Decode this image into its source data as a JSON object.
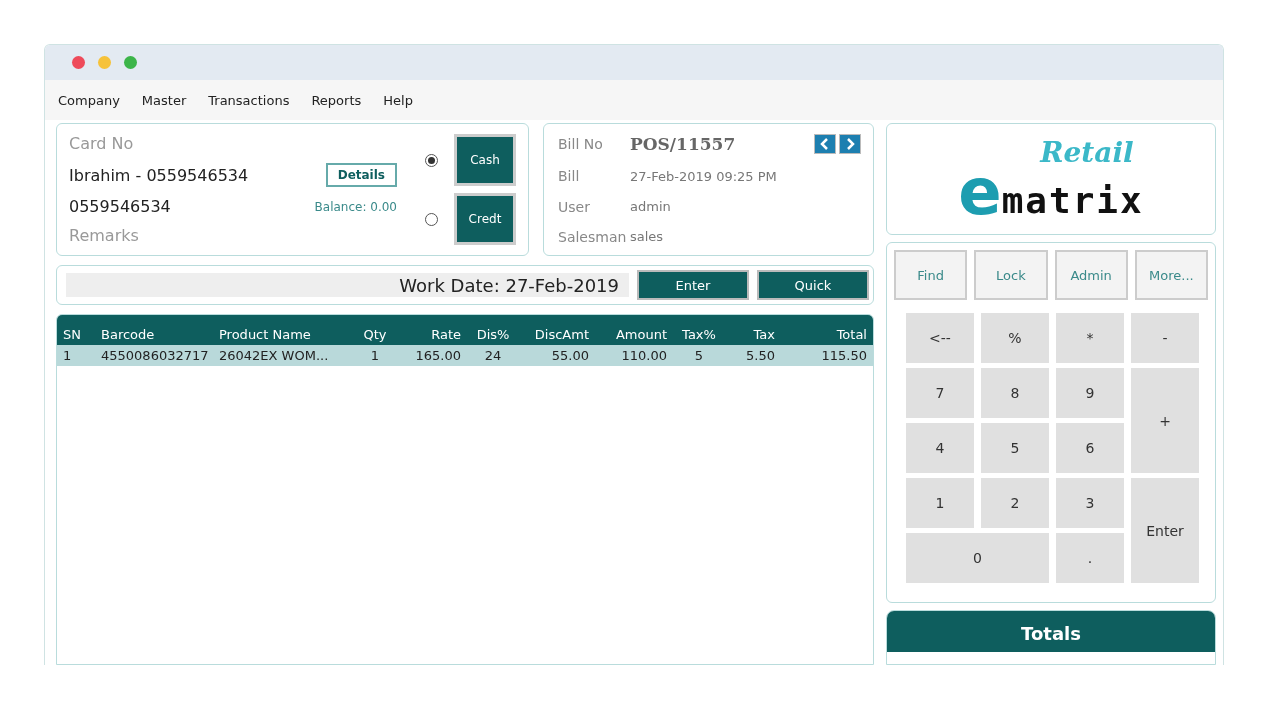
{
  "menu": [
    "Company",
    "Master",
    "Transactions",
    "Reports",
    "Help"
  ],
  "customer": {
    "card_label": "Card No",
    "name": "Ibrahim - 0559546534",
    "phone": "0559546534",
    "remarks_label": "Remarks",
    "details_button": "Details",
    "balance": "Balance: 0.00"
  },
  "payment_options": [
    {
      "label": "Cash",
      "selected": true
    },
    {
      "label": "Credt",
      "selected": false
    }
  ],
  "bill": {
    "fields": [
      {
        "label": "Bill No",
        "value": "POS/11557",
        "kind": "strong"
      },
      {
        "label": "Bill",
        "value": "27-Feb-2019 09:25 PM",
        "kind": "plain"
      },
      {
        "label": "User",
        "value": "admin",
        "kind": "plain"
      },
      {
        "label": "Salesman",
        "value": "sales",
        "kind": "plain"
      }
    ]
  },
  "logo": {
    "tagline": "Retail",
    "mark": "e",
    "name": "matrix"
  },
  "work_date": {
    "value": "Work Date: 27-Feb-2019",
    "buttons": [
      "Enter",
      "Quick"
    ]
  },
  "table": {
    "columns": [
      {
        "label": "SN",
        "kind": "text"
      },
      {
        "label": "Barcode",
        "kind": "text"
      },
      {
        "label": "Product Name",
        "kind": "text"
      },
      {
        "label": "Qty",
        "kind": "count"
      },
      {
        "label": "Rate",
        "kind": "number"
      },
      {
        "label": "Dis%",
        "kind": "count"
      },
      {
        "label": "DiscAmt",
        "kind": "number"
      },
      {
        "label": "Amount",
        "kind": "number"
      },
      {
        "label": "Tax%",
        "kind": "count"
      },
      {
        "label": "Tax",
        "kind": "number"
      },
      {
        "label": "Total",
        "kind": "number"
      }
    ],
    "rows": [
      {
        "selected": true,
        "cells": [
          "1",
          "4550086032717",
          "26042EX WOM...",
          "1",
          "165.00",
          "24",
          "55.00",
          "110.00",
          "5",
          "5.50",
          "115.50"
        ]
      }
    ]
  },
  "actions": [
    "Find",
    "Lock",
    "Admin",
    "More..."
  ],
  "keypad": [
    {
      "label": "<--",
      "kind": "normal"
    },
    {
      "label": "%",
      "kind": "normal"
    },
    {
      "label": "*",
      "kind": "normal"
    },
    {
      "label": "-",
      "kind": "normal"
    },
    {
      "label": "7",
      "kind": "normal"
    },
    {
      "label": "8",
      "kind": "normal"
    },
    {
      "label": "9",
      "kind": "normal"
    },
    {
      "label": "+",
      "kind": "tall"
    },
    {
      "label": "4",
      "kind": "normal"
    },
    {
      "label": "5",
      "kind": "normal"
    },
    {
      "label": "6",
      "kind": "normal"
    },
    {
      "label": "1",
      "kind": "normal"
    },
    {
      "label": "2",
      "kind": "normal"
    },
    {
      "label": "3",
      "kind": "normal"
    },
    {
      "label": "Enter",
      "kind": "tall"
    },
    {
      "label": "0",
      "kind": "wide"
    },
    {
      "label": ".",
      "kind": "normal"
    }
  ],
  "totals": {
    "title": "Totals"
  }
}
